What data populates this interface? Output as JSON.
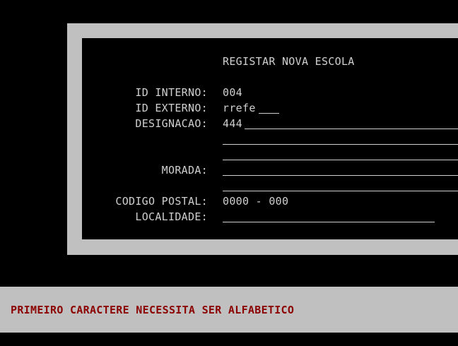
{
  "colors": {
    "background": "#000000",
    "frame": "#c0c0c0",
    "text": "#cfcfcf",
    "error_text": "#8b0000"
  },
  "form": {
    "title": "REGISTAR NOVA ESCOLA",
    "id_interno": {
      "label": "ID INTERNO:",
      "value": "004"
    },
    "id_externo": {
      "label": "ID EXTERNO:",
      "value": "rrefe"
    },
    "designacao": {
      "label": "DESIGNACAO:",
      "value": "444"
    },
    "morada": {
      "label": "MORADA:",
      "value": ""
    },
    "codigo_postal": {
      "label": "CODIGO POSTAL:",
      "value": "0000 - 000"
    },
    "localidade": {
      "label": "LOCALIDADE:",
      "value": ""
    }
  },
  "status": {
    "message": "PRIMEIRO CARACTERE NECESSITA SER ALFABETICO"
  }
}
